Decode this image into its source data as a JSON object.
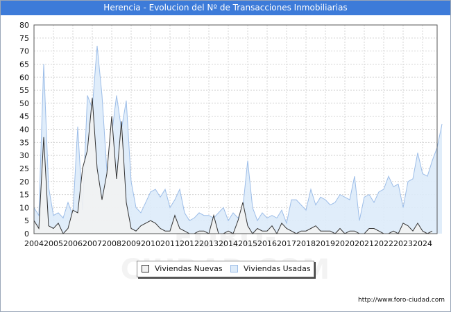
{
  "title": "Herencia - Evolucion del Nº de Transacciones Inmobiliarias",
  "footer_url": "http://www.foro-ciudad.com",
  "watermark": "FORO-CIUDAD.COM",
  "colors": {
    "title_bg": "#3d7bd9",
    "nuevas_fill": "#f2f2f2",
    "nuevas_line": "#333333",
    "usadas_fill": "#ddebf9",
    "usadas_line": "#9cbde8"
  },
  "chart_data": {
    "type": "area",
    "x_tick_labels": [
      "2004",
      "2005",
      "2006",
      "2007",
      "2008",
      "2009",
      "2010",
      "2011",
      "2012",
      "2013",
      "2014",
      "2015",
      "2016",
      "2017",
      "2018",
      "2019",
      "2020",
      "2021",
      "2022",
      "2023",
      "2024"
    ],
    "x_start": 2004.0,
    "x_end": 2024.75,
    "x_step": 0.25,
    "ylim": [
      0,
      80
    ],
    "y_ticks": [
      0,
      5,
      10,
      15,
      20,
      25,
      30,
      35,
      40,
      45,
      50,
      55,
      60,
      65,
      70,
      75,
      80
    ],
    "grid": true,
    "legend_position": "bottom-center",
    "series": [
      {
        "name": "Viviendas Nuevas",
        "values": [
          5,
          2,
          37,
          3,
          2,
          4,
          0,
          2,
          9,
          8,
          25,
          32,
          52,
          25,
          13,
          23,
          45,
          21,
          43,
          12,
          2,
          1,
          3,
          4,
          5,
          4,
          2,
          1,
          1,
          7,
          2,
          1,
          0,
          0,
          1,
          1,
          0,
          7,
          0,
          0,
          1,
          0,
          5,
          12,
          3,
          0,
          2,
          1,
          1,
          3,
          0,
          4,
          2,
          1,
          0,
          1,
          1,
          2,
          3,
          1,
          1,
          1,
          0,
          2,
          0,
          1,
          1,
          0,
          0,
          2,
          2,
          1,
          0,
          0,
          1,
          0,
          4,
          3,
          1,
          4,
          1,
          0,
          1
        ]
      },
      {
        "name": "Viviendas Usadas",
        "values": [
          10,
          7,
          65,
          18,
          7,
          8,
          6,
          12,
          7,
          41,
          9,
          53,
          48,
          72,
          53,
          24,
          38,
          53,
          40,
          51,
          20,
          10,
          8,
          12,
          16,
          17,
          14,
          17,
          10,
          13,
          17,
          8,
          5,
          6,
          8,
          7,
          7,
          6,
          8,
          10,
          5,
          8,
          6,
          10,
          28,
          10,
          5,
          8,
          6,
          7,
          6,
          9,
          4,
          13,
          13,
          11,
          9,
          17,
          11,
          14,
          13,
          11,
          12,
          15,
          14,
          13,
          22,
          5,
          14,
          15,
          12,
          16,
          17,
          22,
          18,
          19,
          10,
          20,
          21,
          31,
          23,
          22,
          28,
          33,
          42
        ]
      }
    ]
  },
  "legend": {
    "nuevas_label": "Viviendas Nuevas",
    "usadas_label": "Viviendas Usadas"
  }
}
